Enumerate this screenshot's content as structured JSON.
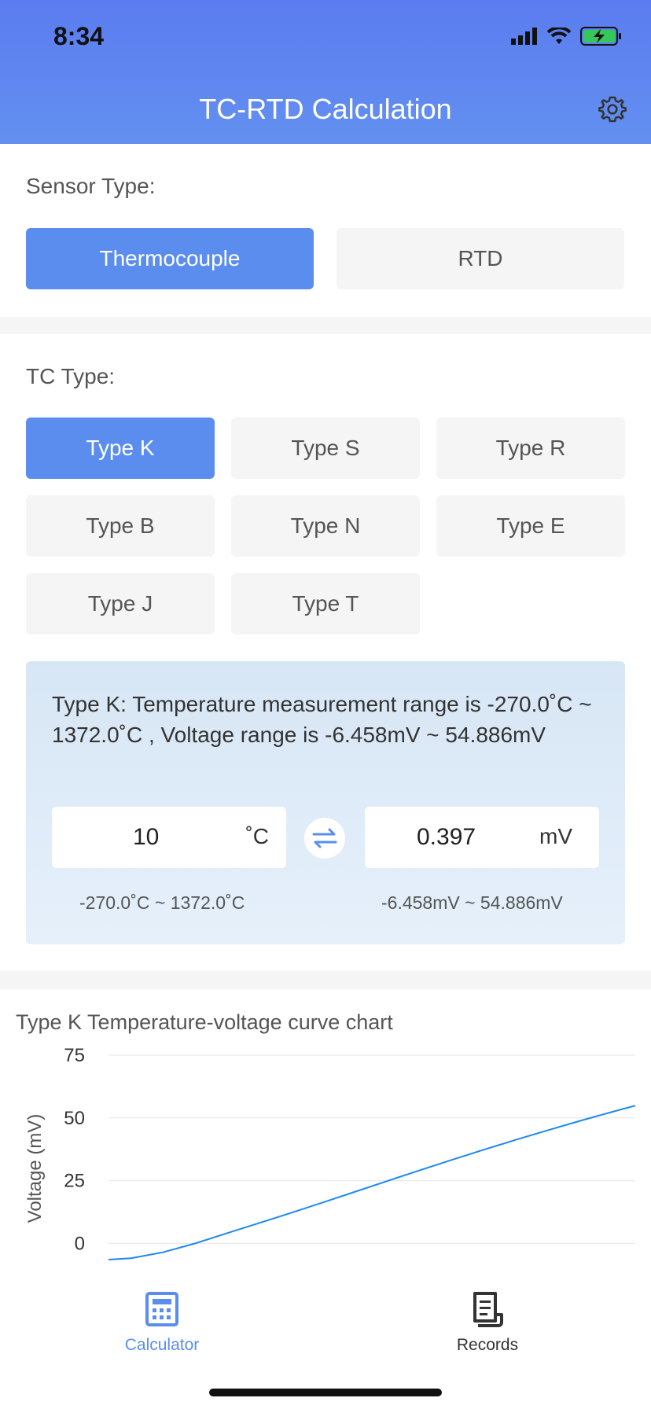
{
  "status": {
    "time": "8:34"
  },
  "header": {
    "title": "TC-RTD Calculation"
  },
  "sensor": {
    "label": "Sensor Type:",
    "options": [
      "Thermocouple",
      "RTD"
    ],
    "selected": "Thermocouple"
  },
  "tc": {
    "label": "TC Type:",
    "types": [
      "Type K",
      "Type S",
      "Type R",
      "Type B",
      "Type N",
      "Type E",
      "Type J",
      "Type T"
    ],
    "selected": "Type K"
  },
  "converter": {
    "info": "Type K: Temperature measurement range is -270.0˚C ~ 1372.0˚C , Voltage range is -6.458mV ~ 54.886mV",
    "temp_value": "10",
    "temp_unit": "˚C",
    "volt_value": "0.397",
    "volt_unit": "mV",
    "temp_range": "-270.0˚C ~ 1372.0˚C",
    "volt_range": "-6.458mV ~ 54.886mV"
  },
  "chart_data": {
    "type": "line",
    "title": "Type K Temperature-voltage curve chart",
    "ylabel": "Voltage (mV)",
    "xlabel": "",
    "ylim": [
      -6.458,
      75
    ],
    "yticks": [
      75,
      50,
      25,
      0
    ],
    "grid": true,
    "series": [
      {
        "x": [
          -270,
          -200,
          -100,
          0,
          100,
          200,
          300,
          400,
          500,
          600,
          700,
          800,
          900,
          1000,
          1100,
          1200,
          1300,
          1372
        ],
        "values": [
          -6.458,
          -5.891,
          -3.554,
          0,
          4.096,
          8.138,
          12.209,
          16.397,
          20.644,
          24.905,
          29.129,
          33.275,
          37.326,
          41.276,
          45.119,
          48.838,
          52.41,
          54.886
        ]
      }
    ],
    "line_color": "#1e88f0"
  },
  "tabbar": {
    "items": [
      {
        "label": "Calculator",
        "active": true
      },
      {
        "label": "Records",
        "active": false
      }
    ]
  },
  "colors": {
    "accent": "#5b8def",
    "header": "#5b7cf0",
    "card": "#dde9f7"
  }
}
